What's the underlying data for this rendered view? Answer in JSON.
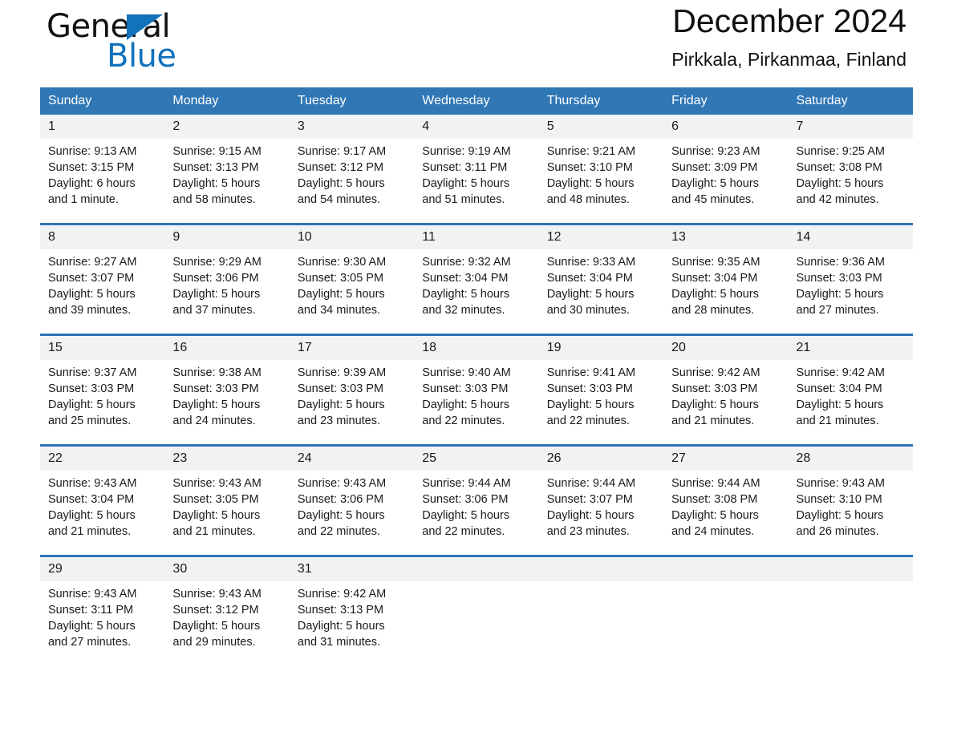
{
  "logo": {
    "word_one": "General",
    "word_two": "Blue",
    "triangle_icon": "triangle-icon",
    "brand_color": "#1272bb"
  },
  "header": {
    "title": "December 2024",
    "subtitle": "Pirkkala, Pirkanmaa, Finland",
    "header_bg_color": "#3077b5",
    "row_divider_color": "#2e74b5",
    "daynum_bg_color": "#f2f2f2"
  },
  "weekdays": [
    "Sunday",
    "Monday",
    "Tuesday",
    "Wednesday",
    "Thursday",
    "Friday",
    "Saturday"
  ],
  "weeks": [
    [
      {
        "day": "1",
        "sunrise": "Sunrise: 9:13 AM",
        "sunset": "Sunset: 3:15 PM",
        "daylight_1": "Daylight: 6 hours",
        "daylight_2": "and 1 minute."
      },
      {
        "day": "2",
        "sunrise": "Sunrise: 9:15 AM",
        "sunset": "Sunset: 3:13 PM",
        "daylight_1": "Daylight: 5 hours",
        "daylight_2": "and 58 minutes."
      },
      {
        "day": "3",
        "sunrise": "Sunrise: 9:17 AM",
        "sunset": "Sunset: 3:12 PM",
        "daylight_1": "Daylight: 5 hours",
        "daylight_2": "and 54 minutes."
      },
      {
        "day": "4",
        "sunrise": "Sunrise: 9:19 AM",
        "sunset": "Sunset: 3:11 PM",
        "daylight_1": "Daylight: 5 hours",
        "daylight_2": "and 51 minutes."
      },
      {
        "day": "5",
        "sunrise": "Sunrise: 9:21 AM",
        "sunset": "Sunset: 3:10 PM",
        "daylight_1": "Daylight: 5 hours",
        "daylight_2": "and 48 minutes."
      },
      {
        "day": "6",
        "sunrise": "Sunrise: 9:23 AM",
        "sunset": "Sunset: 3:09 PM",
        "daylight_1": "Daylight: 5 hours",
        "daylight_2": "and 45 minutes."
      },
      {
        "day": "7",
        "sunrise": "Sunrise: 9:25 AM",
        "sunset": "Sunset: 3:08 PM",
        "daylight_1": "Daylight: 5 hours",
        "daylight_2": "and 42 minutes."
      }
    ],
    [
      {
        "day": "8",
        "sunrise": "Sunrise: 9:27 AM",
        "sunset": "Sunset: 3:07 PM",
        "daylight_1": "Daylight: 5 hours",
        "daylight_2": "and 39 minutes."
      },
      {
        "day": "9",
        "sunrise": "Sunrise: 9:29 AM",
        "sunset": "Sunset: 3:06 PM",
        "daylight_1": "Daylight: 5 hours",
        "daylight_2": "and 37 minutes."
      },
      {
        "day": "10",
        "sunrise": "Sunrise: 9:30 AM",
        "sunset": "Sunset: 3:05 PM",
        "daylight_1": "Daylight: 5 hours",
        "daylight_2": "and 34 minutes."
      },
      {
        "day": "11",
        "sunrise": "Sunrise: 9:32 AM",
        "sunset": "Sunset: 3:04 PM",
        "daylight_1": "Daylight: 5 hours",
        "daylight_2": "and 32 minutes."
      },
      {
        "day": "12",
        "sunrise": "Sunrise: 9:33 AM",
        "sunset": "Sunset: 3:04 PM",
        "daylight_1": "Daylight: 5 hours",
        "daylight_2": "and 30 minutes."
      },
      {
        "day": "13",
        "sunrise": "Sunrise: 9:35 AM",
        "sunset": "Sunset: 3:04 PM",
        "daylight_1": "Daylight: 5 hours",
        "daylight_2": "and 28 minutes."
      },
      {
        "day": "14",
        "sunrise": "Sunrise: 9:36 AM",
        "sunset": "Sunset: 3:03 PM",
        "daylight_1": "Daylight: 5 hours",
        "daylight_2": "and 27 minutes."
      }
    ],
    [
      {
        "day": "15",
        "sunrise": "Sunrise: 9:37 AM",
        "sunset": "Sunset: 3:03 PM",
        "daylight_1": "Daylight: 5 hours",
        "daylight_2": "and 25 minutes."
      },
      {
        "day": "16",
        "sunrise": "Sunrise: 9:38 AM",
        "sunset": "Sunset: 3:03 PM",
        "daylight_1": "Daylight: 5 hours",
        "daylight_2": "and 24 minutes."
      },
      {
        "day": "17",
        "sunrise": "Sunrise: 9:39 AM",
        "sunset": "Sunset: 3:03 PM",
        "daylight_1": "Daylight: 5 hours",
        "daylight_2": "and 23 minutes."
      },
      {
        "day": "18",
        "sunrise": "Sunrise: 9:40 AM",
        "sunset": "Sunset: 3:03 PM",
        "daylight_1": "Daylight: 5 hours",
        "daylight_2": "and 22 minutes."
      },
      {
        "day": "19",
        "sunrise": "Sunrise: 9:41 AM",
        "sunset": "Sunset: 3:03 PM",
        "daylight_1": "Daylight: 5 hours",
        "daylight_2": "and 22 minutes."
      },
      {
        "day": "20",
        "sunrise": "Sunrise: 9:42 AM",
        "sunset": "Sunset: 3:03 PM",
        "daylight_1": "Daylight: 5 hours",
        "daylight_2": "and 21 minutes."
      },
      {
        "day": "21",
        "sunrise": "Sunrise: 9:42 AM",
        "sunset": "Sunset: 3:04 PM",
        "daylight_1": "Daylight: 5 hours",
        "daylight_2": "and 21 minutes."
      }
    ],
    [
      {
        "day": "22",
        "sunrise": "Sunrise: 9:43 AM",
        "sunset": "Sunset: 3:04 PM",
        "daylight_1": "Daylight: 5 hours",
        "daylight_2": "and 21 minutes."
      },
      {
        "day": "23",
        "sunrise": "Sunrise: 9:43 AM",
        "sunset": "Sunset: 3:05 PM",
        "daylight_1": "Daylight: 5 hours",
        "daylight_2": "and 21 minutes."
      },
      {
        "day": "24",
        "sunrise": "Sunrise: 9:43 AM",
        "sunset": "Sunset: 3:06 PM",
        "daylight_1": "Daylight: 5 hours",
        "daylight_2": "and 22 minutes."
      },
      {
        "day": "25",
        "sunrise": "Sunrise: 9:44 AM",
        "sunset": "Sunset: 3:06 PM",
        "daylight_1": "Daylight: 5 hours",
        "daylight_2": "and 22 minutes."
      },
      {
        "day": "26",
        "sunrise": "Sunrise: 9:44 AM",
        "sunset": "Sunset: 3:07 PM",
        "daylight_1": "Daylight: 5 hours",
        "daylight_2": "and 23 minutes."
      },
      {
        "day": "27",
        "sunrise": "Sunrise: 9:44 AM",
        "sunset": "Sunset: 3:08 PM",
        "daylight_1": "Daylight: 5 hours",
        "daylight_2": "and 24 minutes."
      },
      {
        "day": "28",
        "sunrise": "Sunrise: 9:43 AM",
        "sunset": "Sunset: 3:10 PM",
        "daylight_1": "Daylight: 5 hours",
        "daylight_2": "and 26 minutes."
      }
    ],
    [
      {
        "day": "29",
        "sunrise": "Sunrise: 9:43 AM",
        "sunset": "Sunset: 3:11 PM",
        "daylight_1": "Daylight: 5 hours",
        "daylight_2": "and 27 minutes."
      },
      {
        "day": "30",
        "sunrise": "Sunrise: 9:43 AM",
        "sunset": "Sunset: 3:12 PM",
        "daylight_1": "Daylight: 5 hours",
        "daylight_2": "and 29 minutes."
      },
      {
        "day": "31",
        "sunrise": "Sunrise: 9:42 AM",
        "sunset": "Sunset: 3:13 PM",
        "daylight_1": "Daylight: 5 hours",
        "daylight_2": "and 31 minutes."
      },
      {
        "day": "",
        "sunrise": "",
        "sunset": "",
        "daylight_1": "",
        "daylight_2": ""
      },
      {
        "day": "",
        "sunrise": "",
        "sunset": "",
        "daylight_1": "",
        "daylight_2": ""
      },
      {
        "day": "",
        "sunrise": "",
        "sunset": "",
        "daylight_1": "",
        "daylight_2": ""
      },
      {
        "day": "",
        "sunrise": "",
        "sunset": "",
        "daylight_1": "",
        "daylight_2": ""
      }
    ]
  ]
}
